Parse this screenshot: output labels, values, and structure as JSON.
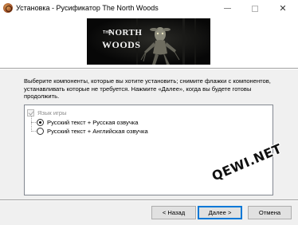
{
  "window": {
    "title": "Установка - Русификатор The North Woods",
    "icon": "installer-app-icon",
    "controls": [
      "minimize",
      "maximize",
      "close"
    ],
    "close_glyph": "✕"
  },
  "banner": {
    "logo_the": "THE",
    "logo_north": "NORTH",
    "logo_woods": "WOODS"
  },
  "description": "Выберите компоненты, которые вы хотите установить; снимите флажки с компонентов, устанавливать которые не требуется. Нажмите «Далее», когда вы будете готовы продолжить.",
  "components": {
    "group": {
      "label": "Язык игры",
      "checked": true,
      "disabled": true
    },
    "options": [
      {
        "label": "Русский текст + Русская озвучка",
        "selected": true
      },
      {
        "label": "Русский текст + Английская озвучка",
        "selected": false
      }
    ]
  },
  "watermark": "QEWI.NET",
  "buttons": {
    "back": "< Назад",
    "next": "Далее >",
    "cancel": "Отмена"
  }
}
